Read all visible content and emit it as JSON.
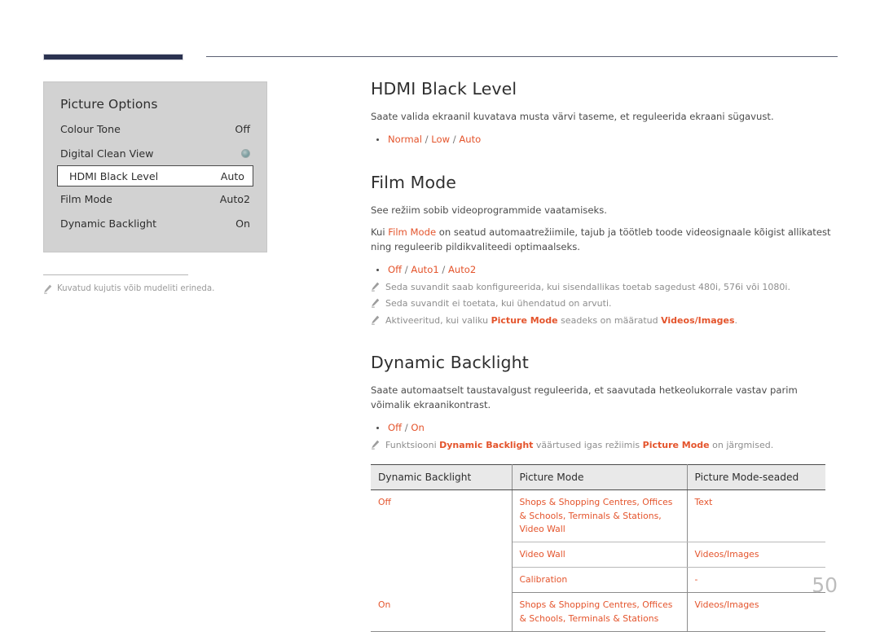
{
  "page": {
    "number": "50"
  },
  "osd": {
    "title": "Picture Options",
    "rows": [
      {
        "label": "Colour Tone",
        "value": "Off",
        "type": "text",
        "selected": false
      },
      {
        "label": "Digital Clean View",
        "value": "",
        "type": "dot",
        "selected": false
      },
      {
        "label": "HDMI Black Level",
        "value": "Auto",
        "type": "text",
        "selected": true
      },
      {
        "label": "Film Mode",
        "value": "Auto2",
        "type": "text",
        "selected": false
      },
      {
        "label": "Dynamic Backlight",
        "value": "On",
        "type": "text",
        "selected": false
      }
    ],
    "caption": "Kuvatud kujutis võib mudeliti erineda."
  },
  "sections": {
    "hdmi_black_level": {
      "heading": "HDMI Black Level",
      "body": "Saate valida ekraanil kuvatava musta värvi taseme, et reguleerida ekraani sügavust.",
      "options": "Normal / Low / Auto",
      "option_parts": [
        "Normal",
        "Low",
        "Auto"
      ]
    },
    "film_mode": {
      "heading": "Film Mode",
      "body1": "See režiim sobib videoprogrammide vaatamiseks.",
      "body2_pre": "Kui ",
      "body2_accent": "Film Mode",
      "body2_post": " on seatud automaatrežiimile, tajub ja töötleb toode videosignaale kõigist allikatest ning reguleerib pildikvaliteedi optimaalseks.",
      "options": "Off / Auto1 / Auto2",
      "option_parts": [
        "Off",
        "Auto1",
        "Auto2"
      ],
      "notes": [
        {
          "text": "Seda suvandit saab konfigureerida, kui sisendallikas toetab sagedust 480i, 576i või 1080i."
        },
        {
          "text": "Seda suvandit ei toetata, kui ühendatud on arvuti."
        }
      ],
      "note3_pre": "Aktiveeritud, kui valiku ",
      "note3_accent1": "Picture Mode",
      "note3_mid": " seadeks on määratud ",
      "note3_accent2": "Videos/Images",
      "note3_post": "."
    },
    "dynamic_backlight": {
      "heading": "Dynamic Backlight",
      "body": "Saate automaatselt taustavalgust reguleerida, et saavutada hetkeolukorrale vastav parim võimalik ekraanikontrast.",
      "options": "Off / On",
      "option_parts": [
        "Off",
        "On"
      ],
      "note_pre": "Funktsiooni ",
      "note_accent1": "Dynamic Backlight",
      "note_mid": " väärtused igas režiimis ",
      "note_accent2": "Picture Mode",
      "note_post": " on järgmised."
    }
  },
  "table": {
    "headers": [
      "Dynamic Backlight",
      "Picture Mode",
      "Picture Mode-seaded"
    ],
    "rows": [
      {
        "backlight": "Off",
        "picture_mode": "Shops & Shopping Centres, Offices & Schools, Terminals & Stations, Video Wall",
        "seaded": "Text",
        "group_start": true
      },
      {
        "backlight": "",
        "picture_mode": "Video Wall",
        "seaded": "Videos/Images",
        "group_start": false
      },
      {
        "backlight": "",
        "picture_mode": "Calibration",
        "seaded": "-",
        "group_start": false
      },
      {
        "backlight": "On",
        "picture_mode": "Shops & Shopping Centres, Offices & Schools, Terminals & Stations",
        "seaded": "Videos/Images",
        "group_start": true
      }
    ]
  },
  "colors": {
    "accent": "#e4542c",
    "navy": "#2b3250",
    "panel_bg": "#d2d2d2",
    "table_header_bg": "#e9e9e9"
  }
}
